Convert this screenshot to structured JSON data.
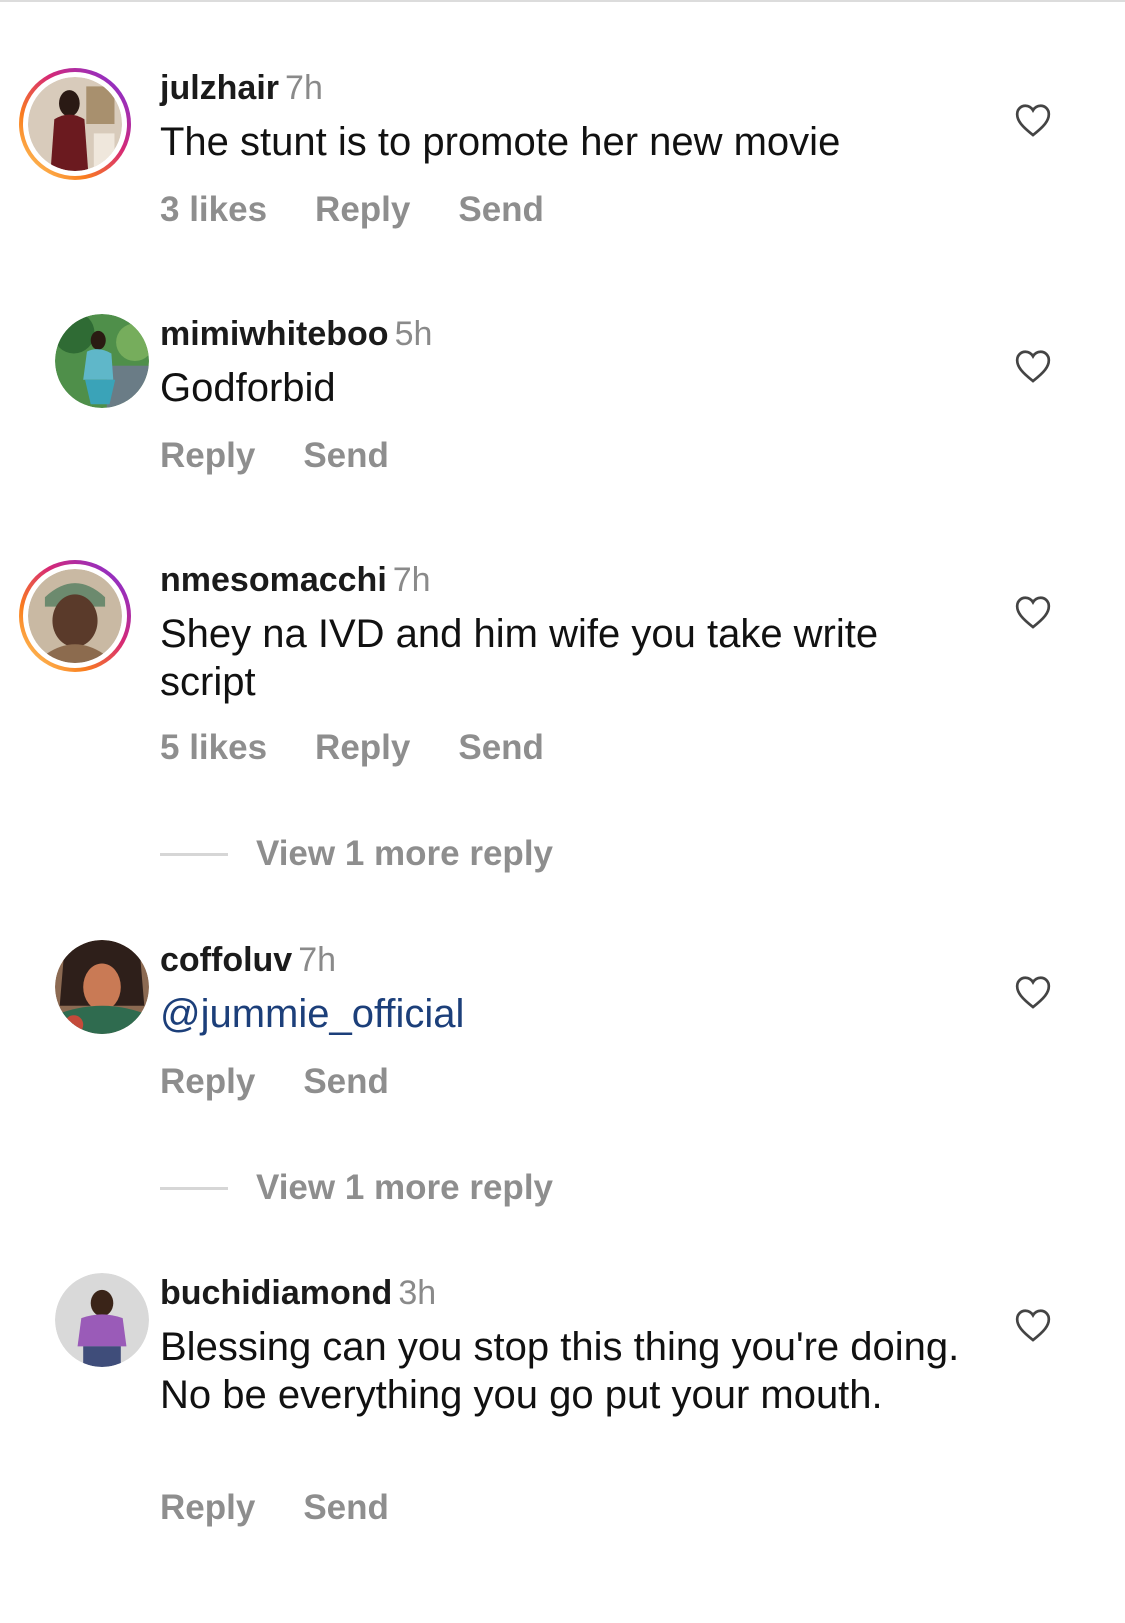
{
  "comments": [
    {
      "username": "julzhair",
      "time": "7h",
      "text": "The stunt is to promote her new movie",
      "likes": "3 likes",
      "reply": "Reply",
      "send": "Send",
      "has_story": true,
      "avatar_colors": [
        "#6b1a1f",
        "#c9b8a3"
      ]
    },
    {
      "username": "mimiwhiteboo",
      "time": "5h",
      "text": "Godforbid",
      "reply": "Reply",
      "send": "Send",
      "has_story": false,
      "avatar_colors": [
        "#3e8c5a",
        "#5fb7c9"
      ]
    },
    {
      "username": "nmesomacchi",
      "time": "7h",
      "text": "Shey na IVD and him wife you take write script",
      "likes": "5 likes",
      "reply": "Reply",
      "send": "Send",
      "view_more": "View 1 more reply",
      "has_story": true,
      "avatar_colors": [
        "#5a3a2a",
        "#b9a58c"
      ]
    },
    {
      "username": "coffoluv",
      "time": "7h",
      "text": "@jummie_official",
      "reply": "Reply",
      "send": "Send",
      "view_more": "View 1 more reply",
      "has_story": false,
      "avatar_colors": [
        "#2e1f1a",
        "#c97a55"
      ]
    },
    {
      "username": "buchidiamond",
      "time": "3h",
      "text": "Blessing can you stop this thing you're doing. No be everything you go put your mouth.",
      "reply": "Reply",
      "send": "Send",
      "has_story": false,
      "avatar_colors": [
        "#8a4fa8",
        "#d7d7d7"
      ]
    }
  ],
  "icons": {
    "like": "heart-outline-icon"
  },
  "colors": {
    "mention": "#1c3f7a",
    "meta": "#8e8e8e"
  }
}
